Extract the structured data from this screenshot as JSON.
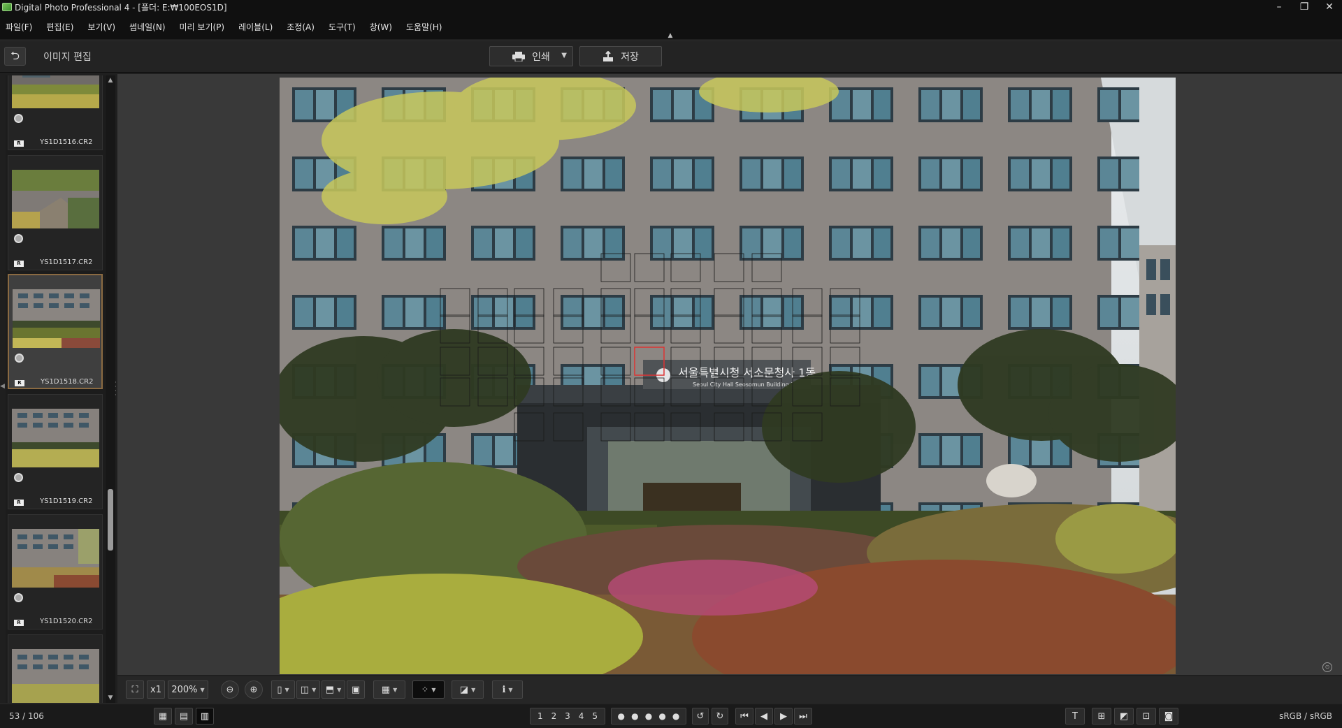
{
  "window": {
    "title": "Digital Photo Professional 4 - [폴더: E:₩100EOS1D]",
    "minimize": "–",
    "maximize": "❐",
    "close": "✕"
  },
  "menu": [
    {
      "label": "파일(F)"
    },
    {
      "label": "편집(E)"
    },
    {
      "label": "보기(V)"
    },
    {
      "label": "썸네일(N)"
    },
    {
      "label": "미리 보기(P)"
    },
    {
      "label": "레이블(L)"
    },
    {
      "label": "조정(A)"
    },
    {
      "label": "도구(T)"
    },
    {
      "label": "창(W)"
    },
    {
      "label": "도움말(H)"
    }
  ],
  "toolbar": {
    "page_title": "이미지 편집",
    "print_label": "인쇄",
    "save_label": "저장"
  },
  "thumbnails": [
    {
      "filename": "YS1D1516.CR2",
      "raw_badge": "R",
      "selected": false
    },
    {
      "filename": "YS1D1517.CR2",
      "raw_badge": "R",
      "selected": false
    },
    {
      "filename": "YS1D1518.CR2",
      "raw_badge": "R",
      "selected": true
    },
    {
      "filename": "YS1D1519.CR2",
      "raw_badge": "R",
      "selected": false
    },
    {
      "filename": "YS1D1520.CR2",
      "raw_badge": "R",
      "selected": false
    },
    {
      "filename": "",
      "raw_badge": "",
      "selected": false
    }
  ],
  "photo": {
    "sign_korean": "서울특별시청 서소문청사 1동",
    "sign_english": "Seoul City Hall Seosomun Building 1"
  },
  "view_controls": {
    "zoom_1x": "x1",
    "zoom_level": "200%"
  },
  "status": {
    "counter": "53 / 106",
    "ratings": [
      "1",
      "2",
      "3",
      "4",
      "5"
    ],
    "colorspace": "sRGB / sRGB"
  },
  "colors": {
    "accent_selected": "#8a6a42",
    "background": "#1f1f1f",
    "viewer": "#393939"
  },
  "icons": [
    "back-arrow-icon",
    "printer-icon",
    "save-icon",
    "fullscreen-icon",
    "zoom-out-icon",
    "zoom-in-icon",
    "grid-icon",
    "info-icon",
    "first-icon",
    "prev-icon",
    "next-icon",
    "last-icon"
  ]
}
